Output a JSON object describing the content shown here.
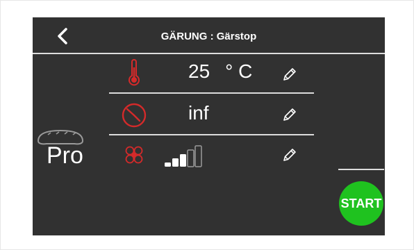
{
  "header": {
    "title": "GÄRUNG : Gärstop",
    "back_icon": "chevron-left-icon"
  },
  "settings": [
    {
      "icon": "thermometer-icon",
      "value": "25",
      "unit": "° C",
      "edit_icon": "pencil-icon"
    },
    {
      "icon": "timer-icon",
      "value": "inf",
      "edit_icon": "pencil-icon"
    },
    {
      "icon": "fan-icon",
      "level": 3,
      "max_level": 5,
      "edit_icon": "pencil-icon"
    }
  ],
  "program": {
    "label": "Pro",
    "icon": "bread-icon"
  },
  "actions": {
    "start_label": "START"
  },
  "colors": {
    "screen_bg": "#313131",
    "accent_red": "#d42a2a",
    "start_green": "#1fc21f",
    "text": "#ffffff"
  }
}
